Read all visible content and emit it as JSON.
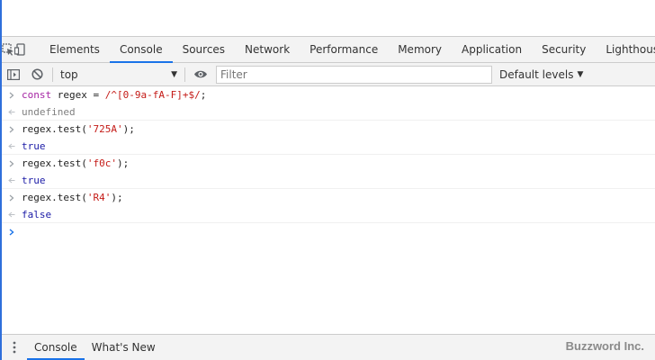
{
  "tabs": [
    "Elements",
    "Console",
    "Sources",
    "Network",
    "Performance",
    "Memory",
    "Application",
    "Security",
    "Lighthouse"
  ],
  "active_tab": "Console",
  "toolbar": {
    "context": "top",
    "filter_placeholder": "Filter",
    "levels_label": "Default levels"
  },
  "console": {
    "lines": [
      {
        "kind": "input",
        "text": "const regex = /^[0-9a-fA-F]+$/;"
      },
      {
        "kind": "output",
        "text": "undefined"
      },
      {
        "kind": "input",
        "text": "regex.test('725A');"
      },
      {
        "kind": "output",
        "text": "true"
      },
      {
        "kind": "input",
        "text": "regex.test('f0c');"
      },
      {
        "kind": "output",
        "text": "true"
      },
      {
        "kind": "input",
        "text": "regex.test('R4');"
      },
      {
        "kind": "output",
        "text": "false"
      }
    ]
  },
  "drawer": {
    "tabs": [
      "Console",
      "What's New"
    ],
    "active": "Console"
  },
  "brand": "Buzzword Inc.",
  "colors": {
    "accent": "#1a73e8",
    "prompt": "#1a73e8",
    "string": "#c41a16",
    "keyword": "#a626a4",
    "boolean": "#1a1aa6",
    "undefined": "#808080"
  }
}
